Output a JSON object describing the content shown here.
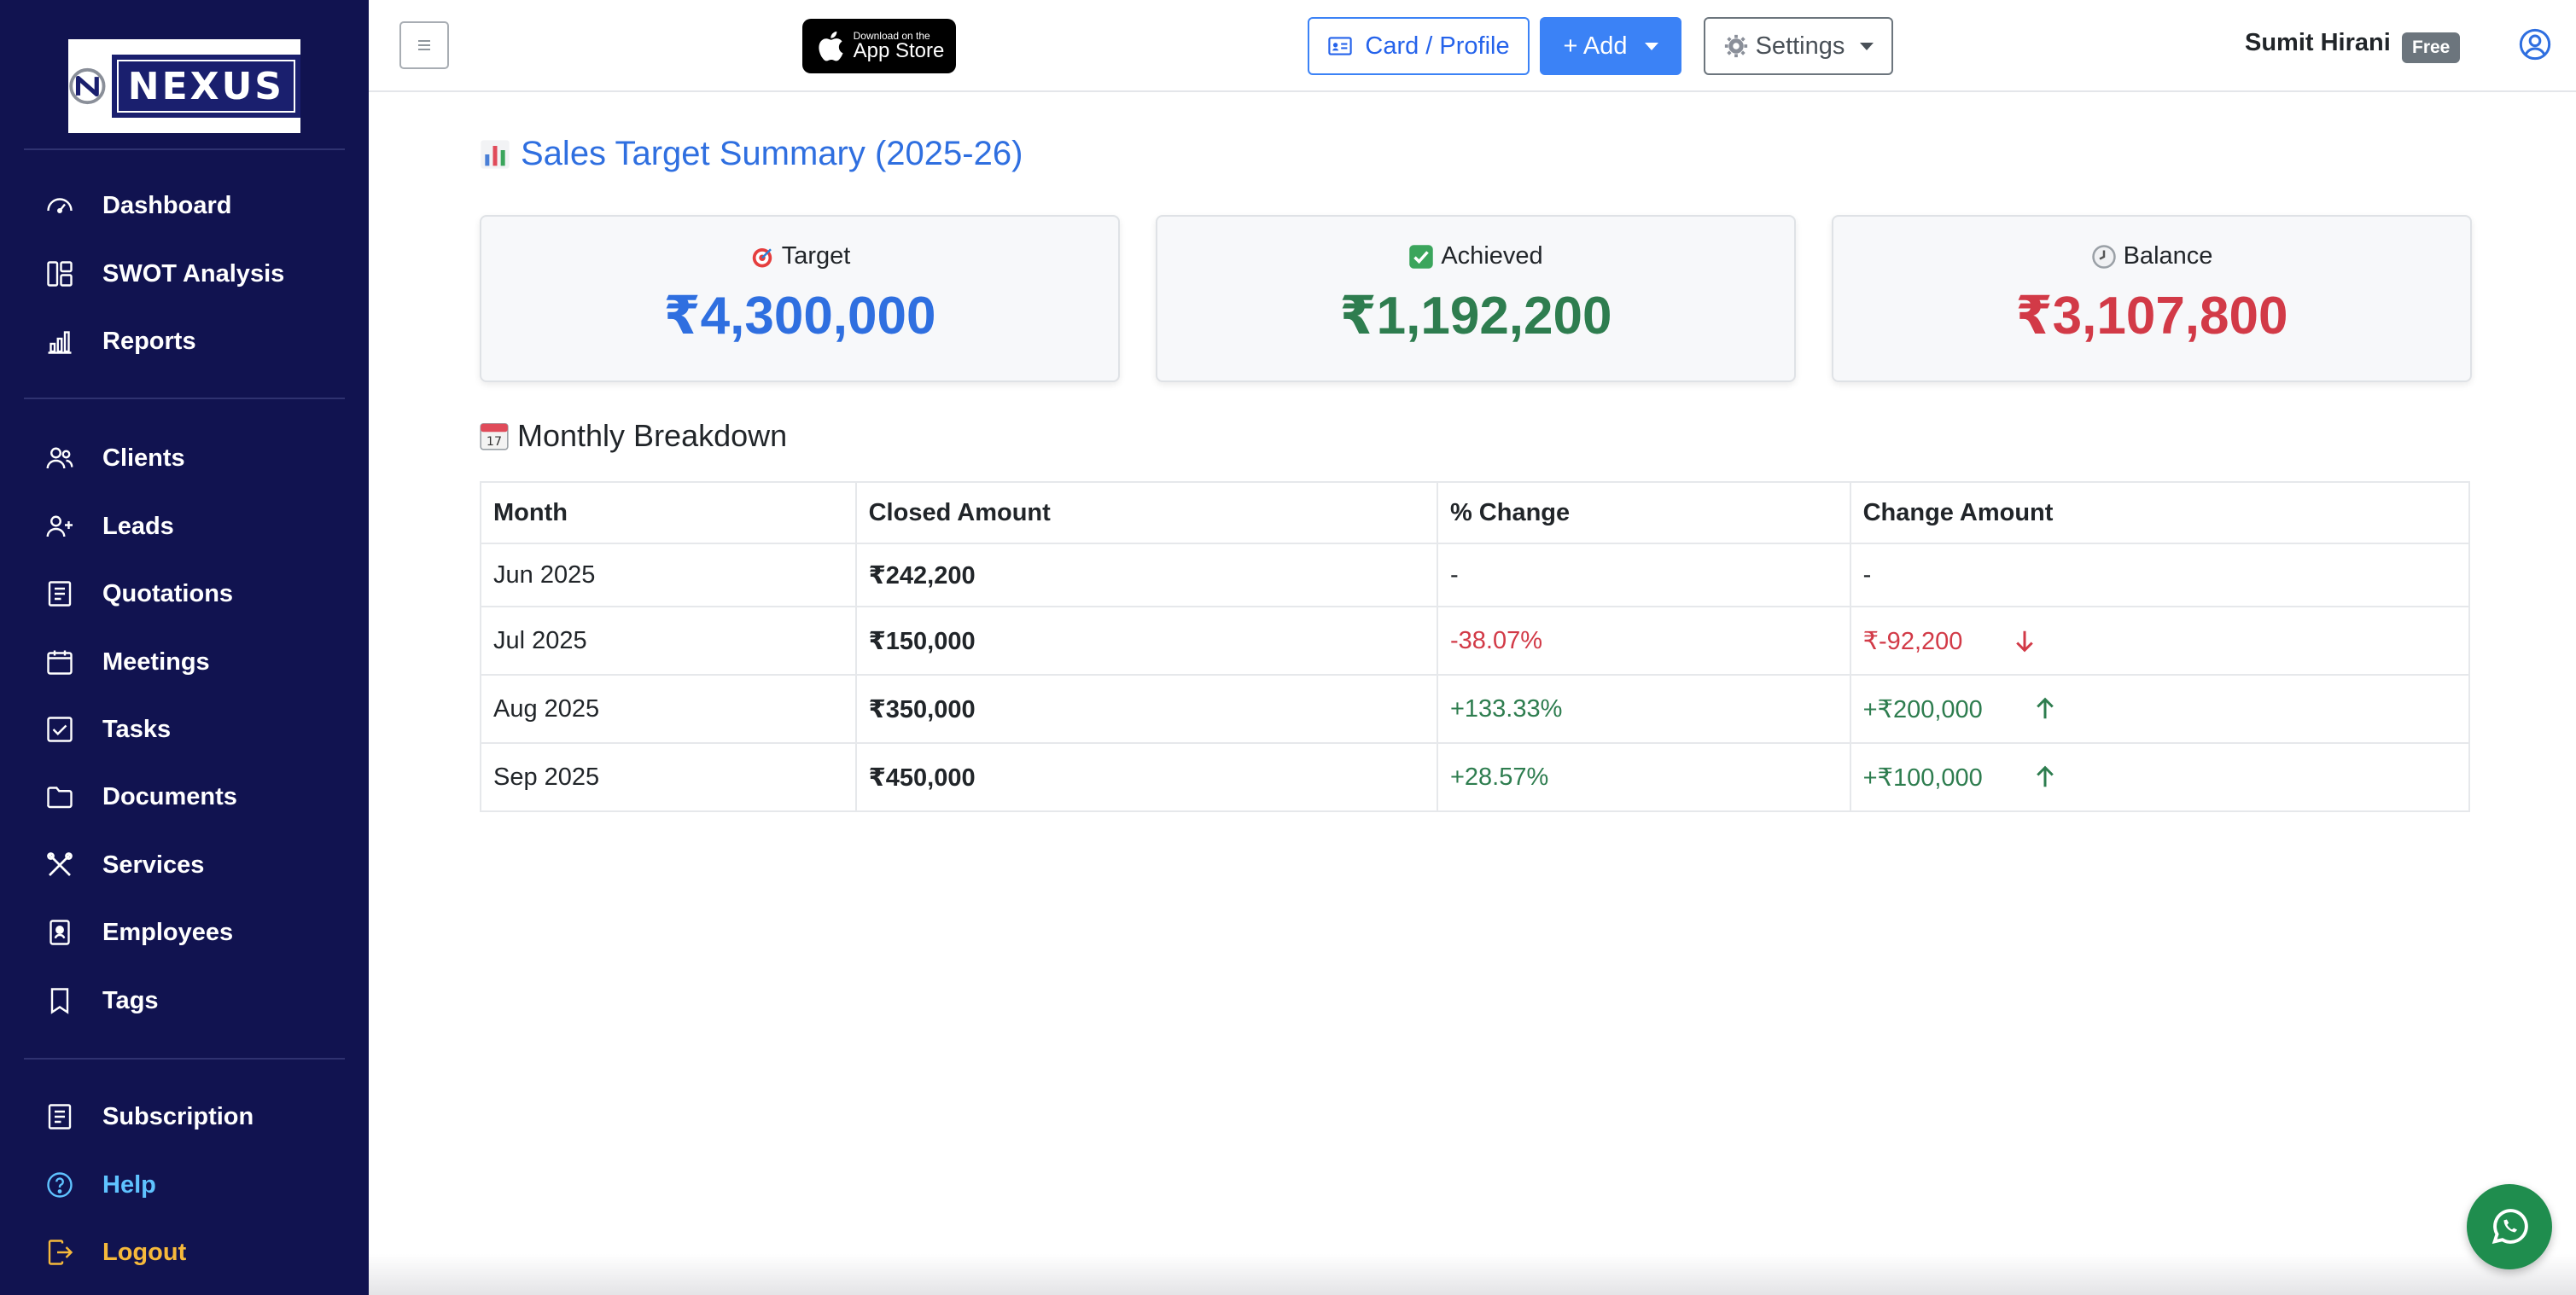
{
  "brand": {
    "logo_text": "NEXUS"
  },
  "sidebar": {
    "items": [
      {
        "label": "Dashboard",
        "icon": "speedometer-icon"
      },
      {
        "label": "SWOT Analysis",
        "icon": "layout-grid-icon"
      },
      {
        "label": "Reports",
        "icon": "bar-chart-icon"
      },
      {
        "label": "Clients",
        "icon": "people-icon"
      },
      {
        "label": "Leads",
        "icon": "person-plus-icon"
      },
      {
        "label": "Quotations",
        "icon": "receipt-icon"
      },
      {
        "label": "Meetings",
        "icon": "calendar-icon"
      },
      {
        "label": "Tasks",
        "icon": "check-square-icon"
      },
      {
        "label": "Documents",
        "icon": "folder-icon"
      },
      {
        "label": "Services",
        "icon": "tools-icon"
      },
      {
        "label": "Employees",
        "icon": "id-badge-icon"
      },
      {
        "label": "Tags",
        "icon": "bookmark-icon"
      },
      {
        "label": "Subscription",
        "icon": "receipt-icon"
      },
      {
        "label": "Help",
        "icon": "question-circle-icon"
      },
      {
        "label": "Logout",
        "icon": "logout-icon"
      }
    ]
  },
  "topbar": {
    "appstore_small": "Download on the",
    "appstore_big": "App Store",
    "card_profile_label": "Card / Profile",
    "add_label": "+ Add",
    "settings_label": "Settings",
    "user_name": "Sumit Hirani",
    "plan_badge": "Free"
  },
  "summary": {
    "title": "Sales Target Summary (2025-26)",
    "cards": [
      {
        "label": "Target",
        "value": "₹4,300,000",
        "color": "#2f6fe0"
      },
      {
        "label": "Achieved",
        "value": "₹1,192,200",
        "color": "#2e7d4f"
      },
      {
        "label": "Balance",
        "value": "₹3,107,800",
        "color": "#d23a47"
      }
    ]
  },
  "breakdown": {
    "title": "Monthly Breakdown",
    "columns": [
      "Month",
      "Closed Amount",
      "% Change",
      "Change Amount"
    ],
    "rows": [
      {
        "month": "Jun 2025",
        "closed": "₹242,200",
        "pct": "-",
        "change": "-",
        "direction": "none"
      },
      {
        "month": "Jul 2025",
        "closed": "₹150,000",
        "pct": "-38.07%",
        "change": "₹-92,200",
        "direction": "down"
      },
      {
        "month": "Aug 2025",
        "closed": "₹350,000",
        "pct": "+133.33%",
        "change": "+₹200,000",
        "direction": "up"
      },
      {
        "month": "Sep 2025",
        "closed": "₹450,000",
        "pct": "+28.57%",
        "change": "+₹100,000",
        "direction": "up"
      }
    ]
  },
  "colors": {
    "sidebar_bg": "#111350",
    "accent": "#3b82f6",
    "positive": "#2e7d4f",
    "negative": "#d23a47"
  }
}
